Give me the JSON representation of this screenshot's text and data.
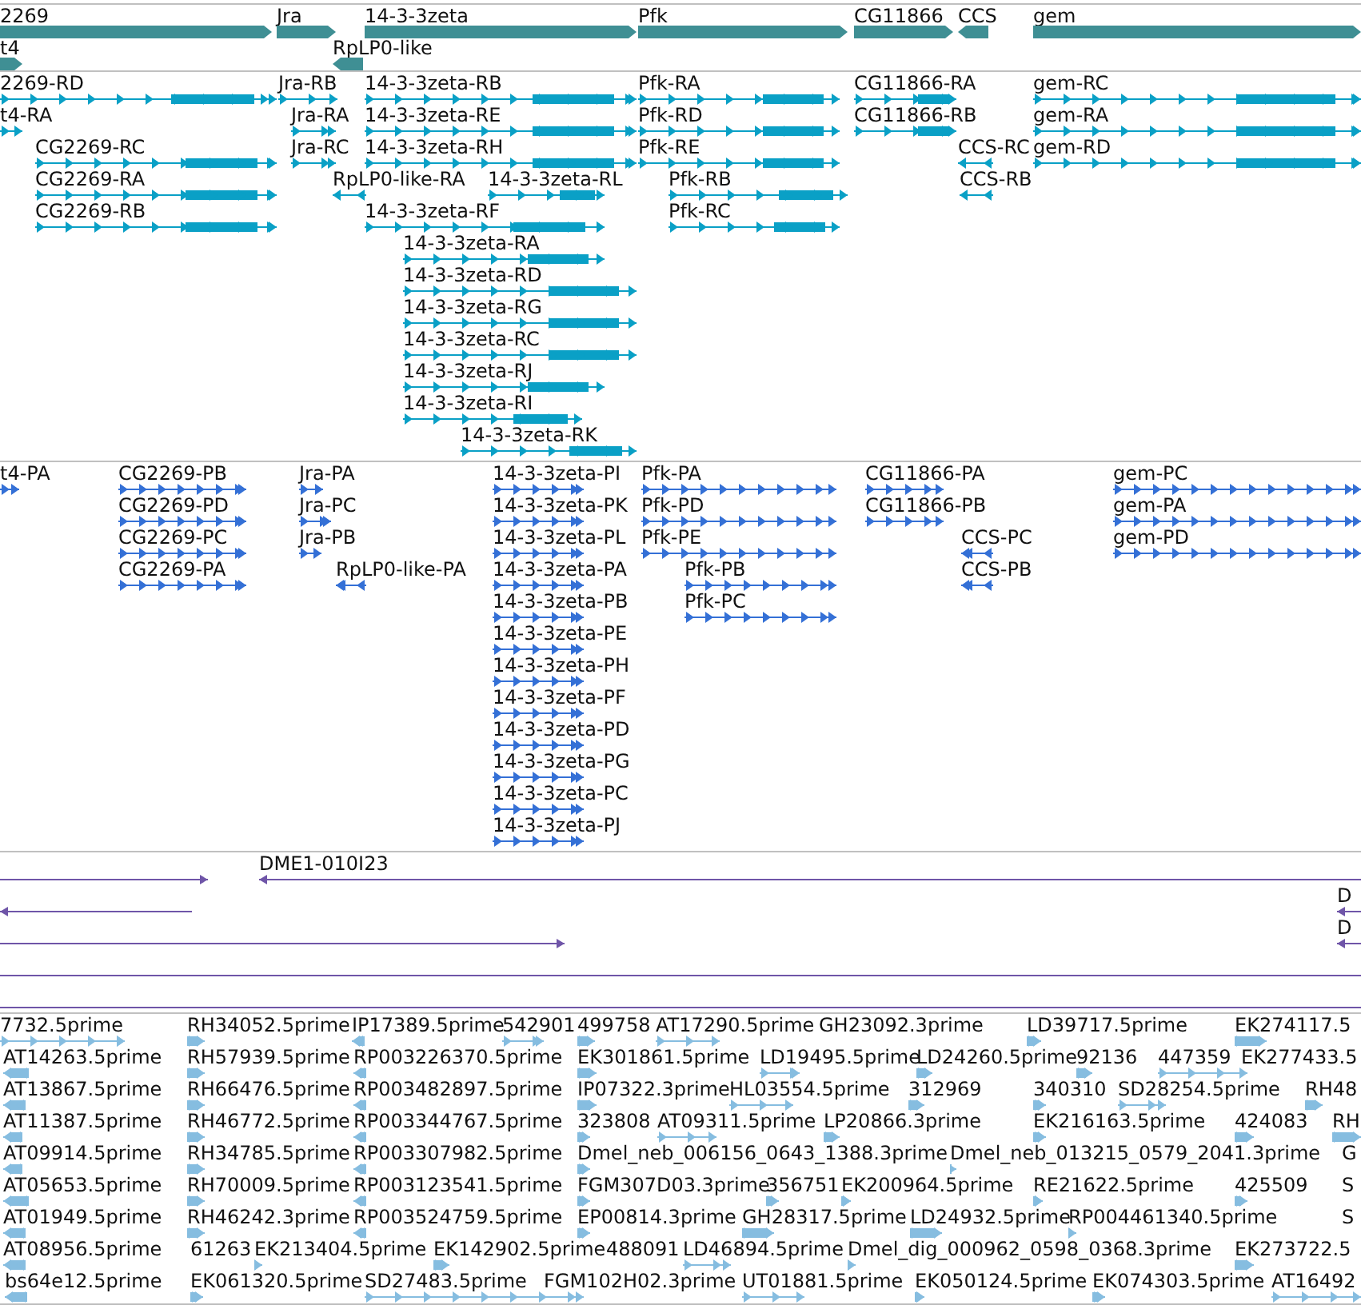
{
  "tracks": [
    {
      "kind": "gene",
      "lanes": [
        {
          "features": [
            {
              "label": "2269",
              "reverse": false
            },
            {
              "label": "Jra",
              "reverse": false
            },
            {
              "label": "14-3-3zeta",
              "reverse": false
            },
            {
              "label": "Pfk",
              "reverse": false
            },
            {
              "label": "CG11866",
              "reverse": false
            },
            {
              "label": "CCS",
              "reverse": true
            },
            {
              "label": "gem",
              "reverse": false
            }
          ]
        },
        {
          "features": [
            {
              "label": "t4",
              "reverse": false
            },
            {
              "label": "RpLP0-like",
              "reverse": true
            }
          ]
        }
      ]
    },
    {
      "kind": "transcript",
      "lanes": [
        {
          "features": [
            {
              "label": "2269-RD",
              "reverse": false
            },
            {
              "label": "Jra-RB",
              "reverse": false
            },
            {
              "label": "14-3-3zeta-RB",
              "reverse": false
            },
            {
              "label": "Pfk-RA",
              "reverse": false
            },
            {
              "label": "CG11866-RA",
              "reverse": false
            },
            {
              "label": "gem-RC",
              "reverse": false
            }
          ]
        },
        {
          "features": [
            {
              "label": "t4-RA",
              "reverse": false
            },
            {
              "label": "Jra-RA",
              "reverse": false
            },
            {
              "label": "14-3-3zeta-RE",
              "reverse": false
            },
            {
              "label": "Pfk-RD",
              "reverse": false
            },
            {
              "label": "CG11866-RB",
              "reverse": false
            },
            {
              "label": "gem-RA",
              "reverse": false
            }
          ]
        },
        {
          "features": [
            {
              "label": "CG2269-RC",
              "reverse": false
            },
            {
              "label": "Jra-RC",
              "reverse": false
            },
            {
              "label": "14-3-3zeta-RH",
              "reverse": false
            },
            {
              "label": "Pfk-RE",
              "reverse": false
            },
            {
              "label": "CCS-RC",
              "reverse": true
            },
            {
              "label": "gem-RD",
              "reverse": false
            }
          ]
        },
        {
          "features": [
            {
              "label": "CG2269-RA",
              "reverse": false
            },
            {
              "label": "RpLP0-like-RA",
              "reverse": true
            },
            {
              "label": "14-3-3zeta-RL",
              "reverse": false
            },
            {
              "label": "Pfk-RB",
              "reverse": false
            },
            {
              "label": "CCS-RB",
              "reverse": true
            }
          ]
        },
        {
          "features": [
            {
              "label": "CG2269-RB",
              "reverse": false
            },
            {
              "label": "14-3-3zeta-RF",
              "reverse": false
            },
            {
              "label": "Pfk-RC",
              "reverse": false
            }
          ]
        },
        {
          "features": [
            {
              "label": "14-3-3zeta-RA",
              "reverse": false
            }
          ]
        },
        {
          "features": [
            {
              "label": "14-3-3zeta-RD",
              "reverse": false
            }
          ]
        },
        {
          "features": [
            {
              "label": "14-3-3zeta-RG",
              "reverse": false
            }
          ]
        },
        {
          "features": [
            {
              "label": "14-3-3zeta-RC",
              "reverse": false
            }
          ]
        },
        {
          "features": [
            {
              "label": "14-3-3zeta-RJ",
              "reverse": false
            }
          ]
        },
        {
          "features": [
            {
              "label": "14-3-3zeta-RI",
              "reverse": false
            }
          ]
        },
        {
          "features": [
            {
              "label": "14-3-3zeta-RK",
              "reverse": false
            }
          ]
        }
      ]
    },
    {
      "kind": "protein",
      "lanes": [
        {
          "features": [
            {
              "label": "t4-PA",
              "reverse": false
            },
            {
              "label": "CG2269-PB",
              "reverse": false
            },
            {
              "label": "Jra-PA",
              "reverse": false
            },
            {
              "label": "14-3-3zeta-PI",
              "reverse": false
            },
            {
              "label": "Pfk-PA",
              "reverse": false
            },
            {
              "label": "CG11866-PA",
              "reverse": false
            },
            {
              "label": "gem-PC",
              "reverse": false
            }
          ]
        },
        {
          "features": [
            {
              "label": "CG2269-PD",
              "reverse": false
            },
            {
              "label": "Jra-PC",
              "reverse": false
            },
            {
              "label": "14-3-3zeta-PK",
              "reverse": false
            },
            {
              "label": "Pfk-PD",
              "reverse": false
            },
            {
              "label": "CG11866-PB",
              "reverse": false
            },
            {
              "label": "gem-PA",
              "reverse": false
            }
          ]
        },
        {
          "features": [
            {
              "label": "CG2269-PC",
              "reverse": false
            },
            {
              "label": "Jra-PB",
              "reverse": false
            },
            {
              "label": "14-3-3zeta-PL",
              "reverse": false
            },
            {
              "label": "Pfk-PE",
              "reverse": false
            },
            {
              "label": "CCS-PC",
              "reverse": true
            },
            {
              "label": "gem-PD",
              "reverse": false
            }
          ]
        },
        {
          "features": [
            {
              "label": "CG2269-PA",
              "reverse": false
            },
            {
              "label": "RpLP0-like-PA",
              "reverse": true
            },
            {
              "label": "14-3-3zeta-PA",
              "reverse": false
            },
            {
              "label": "Pfk-PB",
              "reverse": false
            },
            {
              "label": "CCS-PB",
              "reverse": true
            }
          ]
        },
        {
          "features": [
            {
              "label": "14-3-3zeta-PB",
              "reverse": false
            },
            {
              "label": "Pfk-PC",
              "reverse": false
            }
          ]
        },
        {
          "features": [
            {
              "label": "14-3-3zeta-PE",
              "reverse": false
            }
          ]
        },
        {
          "features": [
            {
              "label": "14-3-3zeta-PH",
              "reverse": false
            }
          ]
        },
        {
          "features": [
            {
              "label": "14-3-3zeta-PF",
              "reverse": false
            }
          ]
        },
        {
          "features": [
            {
              "label": "14-3-3zeta-PD",
              "reverse": false
            }
          ]
        },
        {
          "features": [
            {
              "label": "14-3-3zeta-PG",
              "reverse": false
            }
          ]
        },
        {
          "features": [
            {
              "label": "14-3-3zeta-PC",
              "reverse": false
            }
          ]
        },
        {
          "features": [
            {
              "label": "14-3-3zeta-PJ",
              "reverse": false
            }
          ]
        }
      ]
    },
    {
      "kind": "clone",
      "lanes": [
        {
          "features": [
            {
              "kind": "arrow",
              "reverse": false
            },
            {
              "kind": "arrow",
              "label": "DME1-010I23",
              "reverse": true
            }
          ]
        },
        {
          "features": [
            {
              "kind": "arrow",
              "reverse": true
            },
            {
              "kind": "arrow",
              "label": "D",
              "reverse": true
            }
          ]
        },
        {
          "features": [
            {
              "kind": "arrow",
              "reverse": false
            },
            {
              "kind": "arrow",
              "label": "D",
              "reverse": true
            }
          ]
        },
        {
          "features": [
            {
              "kind": "line"
            }
          ]
        },
        {
          "features": [
            {
              "kind": "line"
            }
          ]
        }
      ]
    },
    {
      "kind": "est",
      "lanes": [
        {
          "features": [
            {
              "label": "7732.5prime",
              "reverse": false
            },
            {
              "label": "RH34052.5prime",
              "reverse": false
            },
            {
              "label": "IP17389.5prime",
              "reverse": true
            },
            {
              "label": "542901",
              "reverse": false
            },
            {
              "label": "499758",
              "reverse": false
            },
            {
              "label": "AT17290.5prime",
              "reverse": false
            },
            {
              "label": "GH23092.3prime"
            },
            {
              "label": "LD39717.5prime",
              "reverse": false
            },
            {
              "label": "EK274117.5",
              "reverse": false
            }
          ]
        },
        {
          "features": [
            {
              "label": "AT14263.5prime",
              "reverse": true
            },
            {
              "label": "RH57939.5prime",
              "reverse": false
            },
            {
              "label": "RP003226370.5prime",
              "reverse": true
            },
            {
              "label": "EK301861.5prime",
              "reverse": false
            },
            {
              "label": "LD19495.5prime",
              "reverse": false
            },
            {
              "label": "LD24260.5prime",
              "reverse": false
            },
            {
              "label": "92136",
              "reverse": false
            },
            {
              "label": "447359",
              "reverse": false
            },
            {
              "label": "EK277433.5"
            }
          ]
        },
        {
          "features": [
            {
              "label": "AT13867.5prime",
              "reverse": true
            },
            {
              "label": "RH66476.5prime",
              "reverse": false
            },
            {
              "label": "RP003482897.5prime",
              "reverse": true
            },
            {
              "label": "IP07322.3prime",
              "reverse": false
            },
            {
              "label": "HL03554.5prime",
              "reverse": false
            },
            {
              "label": "312969",
              "reverse": false
            },
            {
              "label": "340310",
              "reverse": false
            },
            {
              "label": "SD28254.5prime",
              "reverse": false
            },
            {
              "label": "RH48",
              "reverse": false
            }
          ]
        },
        {
          "features": [
            {
              "label": "AT11387.5prime",
              "reverse": true
            },
            {
              "label": "RH46772.5prime",
              "reverse": false
            },
            {
              "label": "RP003344767.5prime",
              "reverse": true
            },
            {
              "label": "323808",
              "reverse": false
            },
            {
              "label": "AT09311.5prime",
              "reverse": false
            },
            {
              "label": "LP20866.3prime",
              "reverse": false
            },
            {
              "label": "EK216163.5prime",
              "reverse": false
            },
            {
              "label": "424083",
              "reverse": false
            },
            {
              "label": "RH",
              "reverse": false
            }
          ]
        },
        {
          "features": [
            {
              "label": "AT09914.5prime",
              "reverse": true
            },
            {
              "label": "RH34785.5prime",
              "reverse": false
            },
            {
              "label": "RP003307982.5prime",
              "reverse": true
            },
            {
              "label": "Dmel_neb_006156_0643_1388.3prime",
              "reverse": false
            },
            {
              "label": "Dmel_neb_013215_0579_2041.3prime",
              "reverse": false
            },
            {
              "label": "G"
            }
          ]
        },
        {
          "features": [
            {
              "label": "AT05653.5prime",
              "reverse": true
            },
            {
              "label": "RH70009.5prime",
              "reverse": false
            },
            {
              "label": "RP003123541.5prime",
              "reverse": true
            },
            {
              "label": "FGM307D03.3prime",
              "reverse": false
            },
            {
              "label": "356751",
              "reverse": false
            },
            {
              "label": "EK200964.5prime",
              "reverse": false
            },
            {
              "label": "RE21622.5prime",
              "reverse": false
            },
            {
              "label": "425509",
              "reverse": false
            },
            {
              "label": "S"
            }
          ]
        },
        {
          "features": [
            {
              "label": "AT01949.5prime",
              "reverse": true
            },
            {
              "label": "RH46242.3prime",
              "reverse": false
            },
            {
              "label": "RP003524759.5prime",
              "reverse": true
            },
            {
              "label": "EP00814.3prime",
              "reverse": false
            },
            {
              "label": "GH28317.5prime",
              "reverse": false
            },
            {
              "label": "LD24932.5prime",
              "reverse": false
            },
            {
              "label": "RP004461340.5prime",
              "reverse": false
            },
            {
              "label": "S"
            }
          ]
        },
        {
          "features": [
            {
              "label": "AT08956.5prime",
              "reverse": true
            },
            {
              "label": "61263"
            },
            {
              "label": "EK213404.5prime",
              "reverse": false
            },
            {
              "label": "EK142902.5prime",
              "reverse": false
            },
            {
              "label": "488091"
            },
            {
              "label": "LD46894.5prime",
              "reverse": false
            },
            {
              "label": "Dmel_dig_000962_0598_0368.3prime",
              "reverse": false
            },
            {
              "label": "EK273722.5",
              "reverse": false
            }
          ]
        },
        {
          "features": [
            {
              "label": "bs64e12.5prime",
              "reverse": true
            },
            {
              "label": "EK061320.5prime",
              "reverse": false
            },
            {
              "label": "SD27483.5prime",
              "reverse": false
            },
            {
              "label": "FGM102H02.3prime"
            },
            {
              "label": "UT01881.5prime",
              "reverse": false
            },
            {
              "label": "EK050124.5prime",
              "reverse": false
            },
            {
              "label": "EK074303.5prime",
              "reverse": false
            },
            {
              "label": "AT16492",
              "reverse": false
            }
          ]
        }
      ]
    }
  ]
}
